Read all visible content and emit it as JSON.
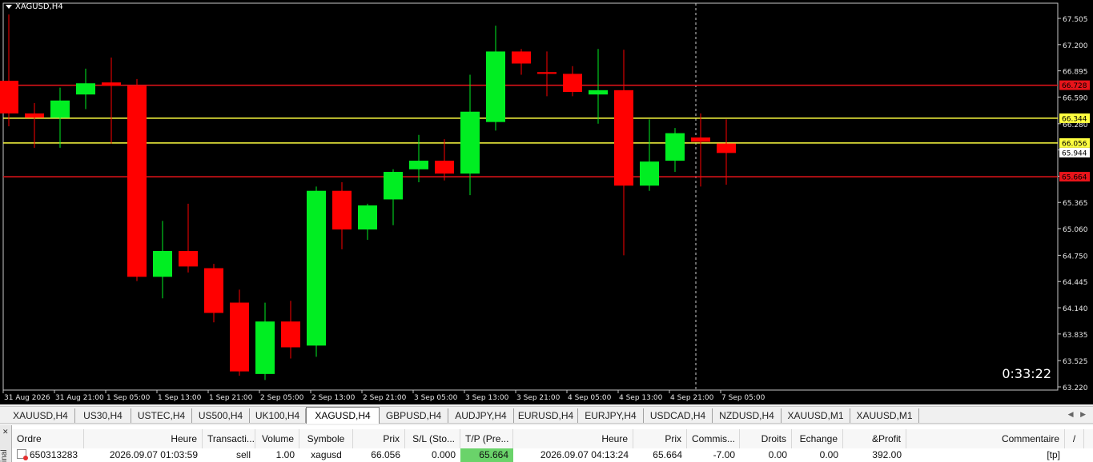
{
  "chart": {
    "title": "XAGUSD,H4",
    "timer": "0:33:22",
    "price_labels": [
      "67.505",
      "67.200",
      "66.895",
      "66.590",
      "66.280",
      "65.975",
      "65.670",
      "65.365",
      "65.060",
      "64.750",
      "64.445",
      "64.140",
      "63.835",
      "63.525",
      "63.220"
    ],
    "time_labels": [
      "31 Aug 2026",
      "31 Aug 21:00",
      "1 Sep 05:00",
      "1 Sep 13:00",
      "1 Sep 21:00",
      "2 Sep 05:00",
      "2 Sep 13:00",
      "2 Sep 21:00",
      "3 Sep 05:00",
      "3 Sep 13:00",
      "3 Sep 21:00",
      "4 Sep 05:00",
      "4 Sep 13:00",
      "4 Sep 21:00",
      "7 Sep 05:00"
    ],
    "levels": [
      {
        "price": 66.728,
        "label": "66.728",
        "color": "#e8141a"
      },
      {
        "price": 66.344,
        "label": "66.344",
        "color": "#ffff40"
      },
      {
        "price": 66.056,
        "label": "66.056",
        "color": "#ffff40"
      },
      {
        "price": 65.944,
        "label": "65.944",
        "color": "#ffffff"
      },
      {
        "price": 65.664,
        "label": "65.664",
        "color": "#e8141a"
      }
    ],
    "bull_color": "#00ee22",
    "bear_color": "#ff0000",
    "candles": [
      {
        "o": 66.78,
        "h": 67.55,
        "l": 66.25,
        "c": 66.4
      },
      {
        "o": 66.4,
        "h": 66.52,
        "l": 66.0,
        "c": 66.35
      },
      {
        "o": 66.35,
        "h": 66.7,
        "l": 66.0,
        "c": 66.55
      },
      {
        "o": 66.62,
        "h": 66.92,
        "l": 66.45,
        "c": 66.75
      },
      {
        "o": 66.76,
        "h": 67.05,
        "l": 66.05,
        "c": 66.72
      },
      {
        "o": 66.72,
        "h": 66.8,
        "l": 64.45,
        "c": 64.5
      },
      {
        "o": 64.5,
        "h": 65.15,
        "l": 64.25,
        "c": 64.8
      },
      {
        "o": 64.8,
        "h": 65.35,
        "l": 64.55,
        "c": 64.62
      },
      {
        "o": 64.6,
        "h": 64.65,
        "l": 63.97,
        "c": 64.08
      },
      {
        "o": 64.2,
        "h": 64.35,
        "l": 63.35,
        "c": 63.4
      },
      {
        "o": 63.37,
        "h": 64.2,
        "l": 63.3,
        "c": 63.98
      },
      {
        "o": 63.98,
        "h": 64.22,
        "l": 63.55,
        "c": 63.68
      },
      {
        "o": 63.7,
        "h": 65.55,
        "l": 63.57,
        "c": 65.5
      },
      {
        "o": 65.5,
        "h": 65.6,
        "l": 64.82,
        "c": 65.05
      },
      {
        "o": 65.05,
        "h": 65.35,
        "l": 64.93,
        "c": 65.33
      },
      {
        "o": 65.4,
        "h": 65.75,
        "l": 65.1,
        "c": 65.72
      },
      {
        "o": 65.75,
        "h": 66.15,
        "l": 65.6,
        "c": 65.85
      },
      {
        "o": 65.85,
        "h": 66.1,
        "l": 65.62,
        "c": 65.7
      },
      {
        "o": 65.7,
        "h": 66.85,
        "l": 65.45,
        "c": 66.42
      },
      {
        "o": 66.3,
        "h": 67.42,
        "l": 66.2,
        "c": 67.12
      },
      {
        "o": 67.12,
        "h": 67.15,
        "l": 66.85,
        "c": 66.98
      },
      {
        "o": 66.88,
        "h": 67.12,
        "l": 66.6,
        "c": 66.86
      },
      {
        "o": 66.86,
        "h": 66.95,
        "l": 66.6,
        "c": 66.65
      },
      {
        "o": 66.62,
        "h": 67.15,
        "l": 66.28,
        "c": 66.67
      },
      {
        "o": 66.67,
        "h": 67.14,
        "l": 64.75,
        "c": 65.56
      },
      {
        "o": 65.56,
        "h": 66.33,
        "l": 65.5,
        "c": 65.84
      },
      {
        "o": 65.85,
        "h": 66.23,
        "l": 65.72,
        "c": 66.17
      },
      {
        "o": 66.12,
        "h": 66.4,
        "l": 65.55,
        "c": 66.07
      },
      {
        "o": 66.05,
        "h": 66.33,
        "l": 65.57,
        "c": 65.94
      }
    ]
  },
  "tabs": [
    "XAUUSD,H4",
    "US30,H4",
    "USTEC,H4",
    "US500,H4",
    "UK100,H4",
    "XAGUSD,H4",
    "GBPUSD,H4",
    "AUDJPY,H4",
    "EURUSD,H4",
    "EURJPY,H4",
    "USDCAD,H4",
    "NZDUSD,H4",
    "XAUUSD,M1",
    "XAUUSD,M1"
  ],
  "tab_arrows": "◀ ▶",
  "terminal": {
    "side_label": "inal",
    "close_glyph": "✕",
    "headers": [
      "Ordre",
      "Heure",
      "Transacti...",
      "Volume",
      "Symbole",
      "Prix",
      "S/L (Sto...",
      "T/P (Pre...",
      "Heure",
      "Prix",
      "Commis...",
      "Droits",
      "Echange",
      "&Profit",
      "Commentaire",
      "/"
    ],
    "row": [
      "650313283",
      "2026.09.07 01:03:59",
      "sell",
      "1.00",
      "xagusd",
      "66.056",
      "0.000",
      "65.664",
      "2026.09.07 04:13:24",
      "65.664",
      "-7.00",
      "0.00",
      "0.00",
      "392.00",
      "[tp]",
      ""
    ]
  }
}
